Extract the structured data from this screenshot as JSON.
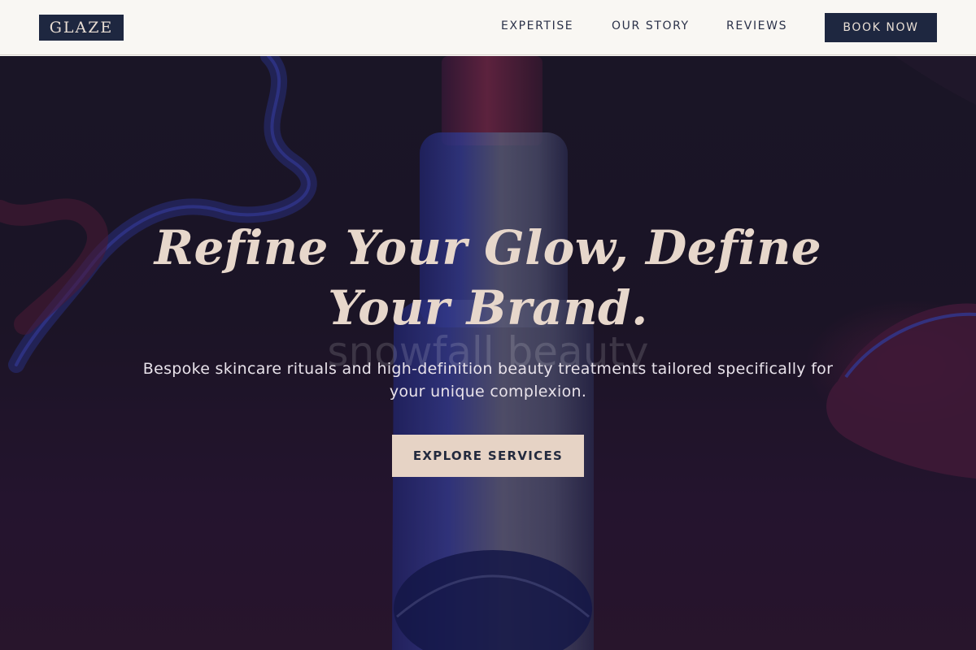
{
  "brand": {
    "logo_text": "GLAZE"
  },
  "nav": {
    "links": [
      {
        "label": "EXPERTISE"
      },
      {
        "label": "OUR STORY"
      },
      {
        "label": "REVIEWS"
      }
    ],
    "cta_label": "BOOK NOW"
  },
  "hero": {
    "title": "Refine Your Glow, Define Your Brand.",
    "watermark": "snowfall beauty",
    "subtitle": "Bespoke skincare rituals and high-definition beauty treatments tailored specifically for your unique complexion.",
    "cta_label": "EXPLORE SERVICES"
  },
  "colors": {
    "nav_background": "#f9f7f3",
    "brand_navy": "#1e2740",
    "accent_blush": "#e6d3c5",
    "hero_dark": "#1b1828"
  }
}
